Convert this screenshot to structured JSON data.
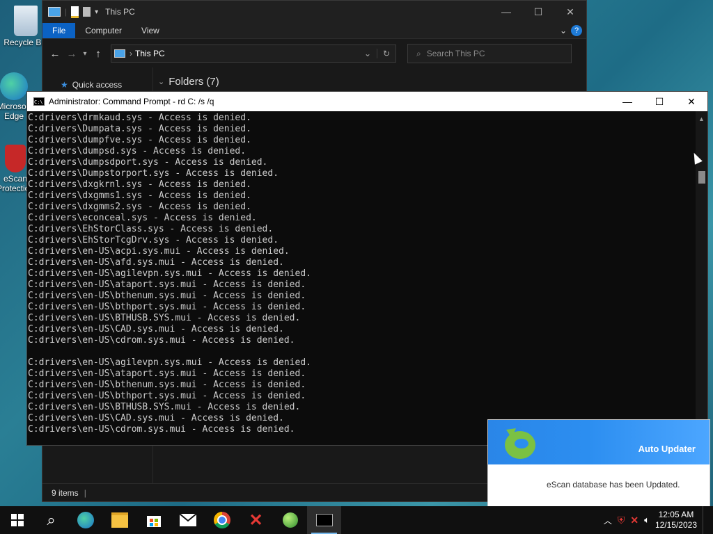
{
  "desktop": {
    "icons": [
      {
        "label": "Recycle Bin"
      },
      {
        "label": "Microsoft Edge"
      },
      {
        "label": "eScan Protection"
      }
    ]
  },
  "explorer": {
    "title": "This PC",
    "ribbon_tabs": [
      "File",
      "Computer",
      "View"
    ],
    "address": "This PC",
    "search_placeholder": "Search This PC",
    "sidebar_quick_access": "Quick access",
    "folders_header": "Folders (7)",
    "status": "9 items"
  },
  "cmd": {
    "title": "Administrator: Command Prompt - rd  C: /s /q",
    "lines": [
      "C:drivers\\drmkaud.sys - Access is denied.",
      "C:drivers\\Dumpata.sys - Access is denied.",
      "C:drivers\\dumpfve.sys - Access is denied.",
      "C:drivers\\dumpsd.sys - Access is denied.",
      "C:drivers\\dumpsdport.sys - Access is denied.",
      "C:drivers\\Dumpstorport.sys - Access is denied.",
      "C:drivers\\dxgkrnl.sys - Access is denied.",
      "C:drivers\\dxgmms1.sys - Access is denied.",
      "C:drivers\\dxgmms2.sys - Access is denied.",
      "C:drivers\\econceal.sys - Access is denied.",
      "C:drivers\\EhStorClass.sys - Access is denied.",
      "C:drivers\\EhStorTcgDrv.sys - Access is denied.",
      "C:drivers\\en-US\\acpi.sys.mui - Access is denied.",
      "C:drivers\\en-US\\afd.sys.mui - Access is denied.",
      "C:drivers\\en-US\\agilevpn.sys.mui - Access is denied.",
      "C:drivers\\en-US\\ataport.sys.mui - Access is denied.",
      "C:drivers\\en-US\\bthenum.sys.mui - Access is denied.",
      "C:drivers\\en-US\\bthport.sys.mui - Access is denied.",
      "C:drivers\\en-US\\BTHUSB.SYS.mui - Access is denied.",
      "C:drivers\\en-US\\CAD.sys.mui - Access is denied.",
      "C:drivers\\en-US\\cdrom.sys.mui - Access is denied.",
      "",
      "C:drivers\\en-US\\agilevpn.sys.mui - Access is denied.",
      "C:drivers\\en-US\\ataport.sys.mui - Access is denied.",
      "C:drivers\\en-US\\bthenum.sys.mui - Access is denied.",
      "C:drivers\\en-US\\bthport.sys.mui - Access is denied.",
      "C:drivers\\en-US\\BTHUSB.SYS.mui - Access is denied.",
      "C:drivers\\en-US\\CAD.sys.mui - Access is denied.",
      "C:drivers\\en-US\\cdrom.sys.mui - Access is denied."
    ]
  },
  "toast": {
    "app": "Auto Updater",
    "message": "eScan database has been Updated."
  },
  "taskbar": {
    "time": "12:05 AM",
    "date": "12/15/2023"
  },
  "colors": {
    "accent": "#0b62c4",
    "toast_blue": "#2c8ef0",
    "escan_green": "#7bc143"
  }
}
